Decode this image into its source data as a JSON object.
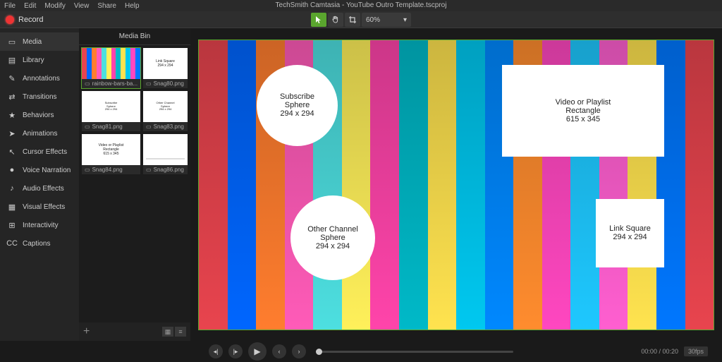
{
  "app_title": "TechSmith Camtasia - YouTube Outro Template.tscproj",
  "menu": [
    "File",
    "Edit",
    "Modify",
    "View",
    "Share",
    "Help"
  ],
  "record_label": "Record",
  "toolbar": {
    "zoom": "60%"
  },
  "sidebar": {
    "items": [
      {
        "label": "Media",
        "icon": "▭"
      },
      {
        "label": "Library",
        "icon": "▤"
      },
      {
        "label": "Annotations",
        "icon": "✎"
      },
      {
        "label": "Transitions",
        "icon": "⇄"
      },
      {
        "label": "Behaviors",
        "icon": "★"
      },
      {
        "label": "Animations",
        "icon": "➤"
      },
      {
        "label": "Cursor Effects",
        "icon": "↖"
      },
      {
        "label": "Voice Narration",
        "icon": "●"
      },
      {
        "label": "Audio Effects",
        "icon": "♪"
      },
      {
        "label": "Visual Effects",
        "icon": "▦"
      },
      {
        "label": "Interactivity",
        "icon": "⊞"
      },
      {
        "label": "Captions",
        "icon": "CC"
      }
    ]
  },
  "mediabin": {
    "title": "Media Bin",
    "items": [
      {
        "label": "rainbow-bars-ba...",
        "thumb_text": ""
      },
      {
        "label": "Snag80.png",
        "thumb_text": "Link Square\n294 x 294"
      },
      {
        "label": "Snag81.png",
        "thumb_text": "Subscribe\nSphere\n294 x 294"
      },
      {
        "label": "Snag83.png",
        "thumb_text": "Other Channel\nSphere\n294 x 294"
      },
      {
        "label": "Snag84.png",
        "thumb_text": "Video or Playlist\nRectangle\n615 x 345"
      },
      {
        "label": "Snag86.png",
        "thumb_text": ""
      }
    ]
  },
  "canvas": {
    "stripe_colors": [
      "#e8444e",
      "#0066ff",
      "#ff7d2e",
      "#ff5bb8",
      "#4ddfe0",
      "#fff05a",
      "#ff44aa",
      "#00b9c8",
      "#ffe34f",
      "#00c8f0",
      "#0088ff",
      "#ff8c2e",
      "#ff47c0",
      "#1ec8ff",
      "#ff5fd0",
      "#ffe34f",
      "#0077ff",
      "#e8444e"
    ],
    "subscribe": {
      "l1": "Subscribe",
      "l2": "Sphere",
      "l3": "294 x 294"
    },
    "other": {
      "l1": "Other Channel",
      "l2": "Sphere",
      "l3": "294 x 294"
    },
    "video": {
      "l1": "Video or Playlist",
      "l2": "Rectangle",
      "l3": "615 x 345"
    },
    "link": {
      "l1": "Link Square",
      "l2": "294 x 294"
    }
  },
  "playback": {
    "time": "00:00 / 00:20",
    "fps": "30fps"
  }
}
